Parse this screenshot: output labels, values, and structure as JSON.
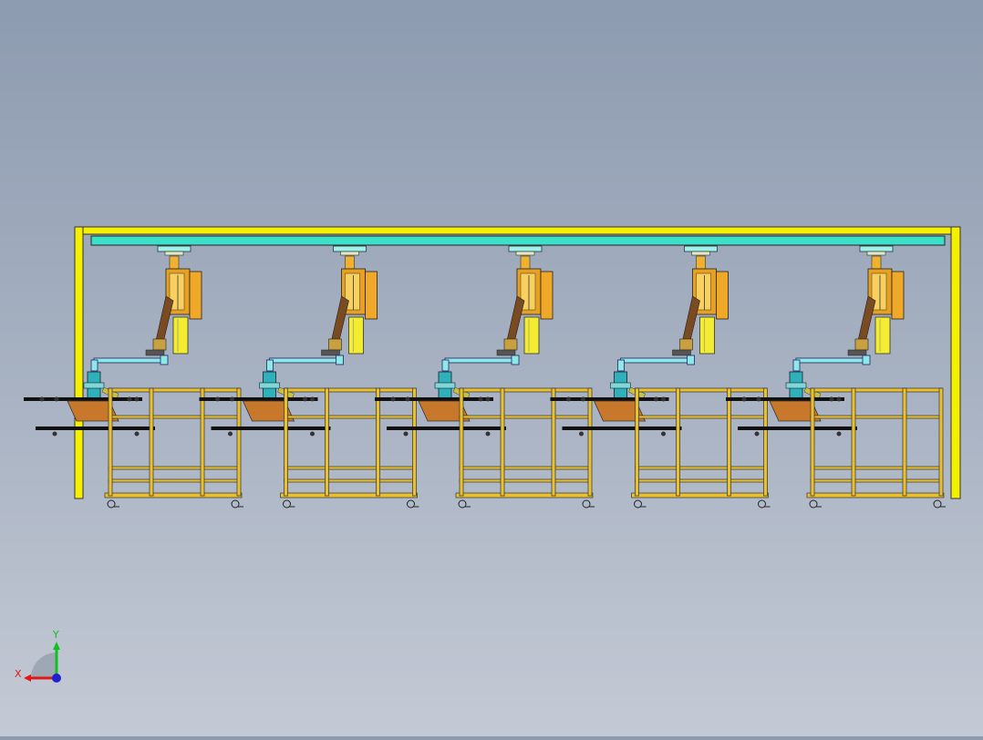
{
  "scene": {
    "background_top": "#8d9bb0",
    "background_bottom": "#c4cad5",
    "frame_color": "#f5f000",
    "beam_color": "#3ce0c8",
    "station_count": 5,
    "station_parts": {
      "cart_frame_color": "#e8c030",
      "table_plate_color": "#c8782a",
      "conveyor_bar_color": "#111111",
      "robot_body_color": "#e8a020",
      "robot_column_color": "#f3ec30",
      "arm_color": "#8fe8e8",
      "gripper_color": "#30b0b8"
    }
  },
  "triad": {
    "x_label": "X",
    "y_label": "Y",
    "x_color": "#e01818",
    "y_color": "#10c020",
    "z_color": "#2020d0"
  }
}
